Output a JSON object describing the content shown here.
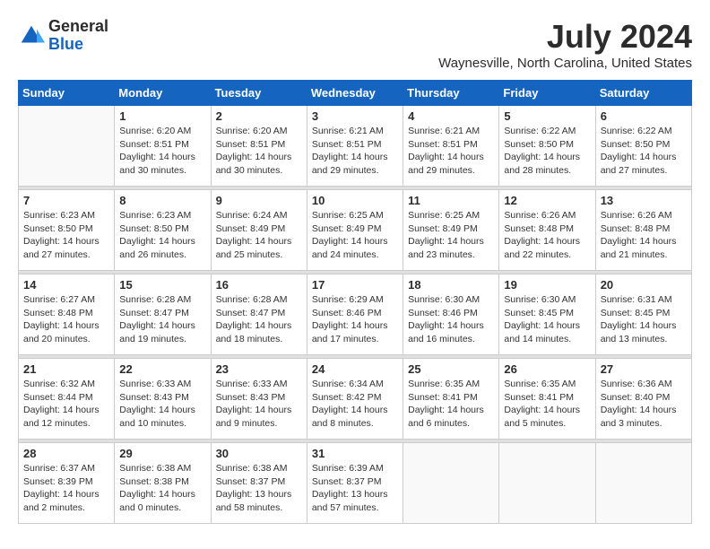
{
  "header": {
    "logo_general": "General",
    "logo_blue": "Blue",
    "month_title": "July 2024",
    "location": "Waynesville, North Carolina, United States"
  },
  "days_of_week": [
    "Sunday",
    "Monday",
    "Tuesday",
    "Wednesday",
    "Thursday",
    "Friday",
    "Saturday"
  ],
  "weeks": [
    [
      {
        "day": "",
        "info": ""
      },
      {
        "day": "1",
        "info": "Sunrise: 6:20 AM\nSunset: 8:51 PM\nDaylight: 14 hours\nand 30 minutes."
      },
      {
        "day": "2",
        "info": "Sunrise: 6:20 AM\nSunset: 8:51 PM\nDaylight: 14 hours\nand 30 minutes."
      },
      {
        "day": "3",
        "info": "Sunrise: 6:21 AM\nSunset: 8:51 PM\nDaylight: 14 hours\nand 29 minutes."
      },
      {
        "day": "4",
        "info": "Sunrise: 6:21 AM\nSunset: 8:51 PM\nDaylight: 14 hours\nand 29 minutes."
      },
      {
        "day": "5",
        "info": "Sunrise: 6:22 AM\nSunset: 8:50 PM\nDaylight: 14 hours\nand 28 minutes."
      },
      {
        "day": "6",
        "info": "Sunrise: 6:22 AM\nSunset: 8:50 PM\nDaylight: 14 hours\nand 27 minutes."
      }
    ],
    [
      {
        "day": "7",
        "info": ""
      },
      {
        "day": "8",
        "info": "Sunrise: 6:23 AM\nSunset: 8:50 PM\nDaylight: 14 hours\nand 26 minutes."
      },
      {
        "day": "9",
        "info": "Sunrise: 6:24 AM\nSunset: 8:49 PM\nDaylight: 14 hours\nand 25 minutes."
      },
      {
        "day": "10",
        "info": "Sunrise: 6:25 AM\nSunset: 8:49 PM\nDaylight: 14 hours\nand 24 minutes."
      },
      {
        "day": "11",
        "info": "Sunrise: 6:25 AM\nSunset: 8:49 PM\nDaylight: 14 hours\nand 23 minutes."
      },
      {
        "day": "12",
        "info": "Sunrise: 6:26 AM\nSunset: 8:48 PM\nDaylight: 14 hours\nand 22 minutes."
      },
      {
        "day": "13",
        "info": "Sunrise: 6:26 AM\nSunset: 8:48 PM\nDaylight: 14 hours\nand 21 minutes."
      }
    ],
    [
      {
        "day": "14",
        "info": ""
      },
      {
        "day": "15",
        "info": "Sunrise: 6:28 AM\nSunset: 8:47 PM\nDaylight: 14 hours\nand 19 minutes."
      },
      {
        "day": "16",
        "info": "Sunrise: 6:28 AM\nSunset: 8:47 PM\nDaylight: 14 hours\nand 18 minutes."
      },
      {
        "day": "17",
        "info": "Sunrise: 6:29 AM\nSunset: 8:46 PM\nDaylight: 14 hours\nand 17 minutes."
      },
      {
        "day": "18",
        "info": "Sunrise: 6:30 AM\nSunset: 8:46 PM\nDaylight: 14 hours\nand 16 minutes."
      },
      {
        "day": "19",
        "info": "Sunrise: 6:30 AM\nSunset: 8:45 PM\nDaylight: 14 hours\nand 14 minutes."
      },
      {
        "day": "20",
        "info": "Sunrise: 6:31 AM\nSunset: 8:45 PM\nDaylight: 14 hours\nand 13 minutes."
      }
    ],
    [
      {
        "day": "21",
        "info": ""
      },
      {
        "day": "22",
        "info": "Sunrise: 6:33 AM\nSunset: 8:43 PM\nDaylight: 14 hours\nand 10 minutes."
      },
      {
        "day": "23",
        "info": "Sunrise: 6:33 AM\nSunset: 8:43 PM\nDaylight: 14 hours\nand 9 minutes."
      },
      {
        "day": "24",
        "info": "Sunrise: 6:34 AM\nSunset: 8:42 PM\nDaylight: 14 hours\nand 8 minutes."
      },
      {
        "day": "25",
        "info": "Sunrise: 6:35 AM\nSunset: 8:41 PM\nDaylight: 14 hours\nand 6 minutes."
      },
      {
        "day": "26",
        "info": "Sunrise: 6:35 AM\nSunset: 8:41 PM\nDaylight: 14 hours\nand 5 minutes."
      },
      {
        "day": "27",
        "info": "Sunrise: 6:36 AM\nSunset: 8:40 PM\nDaylight: 14 hours\nand 3 minutes."
      }
    ],
    [
      {
        "day": "28",
        "info": ""
      },
      {
        "day": "29",
        "info": "Sunrise: 6:38 AM\nSunset: 8:38 PM\nDaylight: 14 hours\nand 0 minutes."
      },
      {
        "day": "30",
        "info": "Sunrise: 6:38 AM\nSunset: 8:37 PM\nDaylight: 13 hours\nand 58 minutes."
      },
      {
        "day": "31",
        "info": "Sunrise: 6:39 AM\nSunset: 8:37 PM\nDaylight: 13 hours\nand 57 minutes."
      },
      {
        "day": "",
        "info": ""
      },
      {
        "day": "",
        "info": ""
      },
      {
        "day": "",
        "info": ""
      }
    ]
  ],
  "week_sunday_info": [
    "Sunrise: 6:23 AM\nSunset: 8:50 PM\nDaylight: 14 hours\nand 27 minutes.",
    "Sunrise: 6:27 AM\nSunset: 8:48 PM\nDaylight: 14 hours\nand 20 minutes.",
    "Sunrise: 6:32 AM\nSunset: 8:44 PM\nDaylight: 14 hours\nand 12 minutes.",
    "Sunrise: 6:37 AM\nSunset: 8:39 PM\nDaylight: 14 hours\nand 2 minutes."
  ]
}
